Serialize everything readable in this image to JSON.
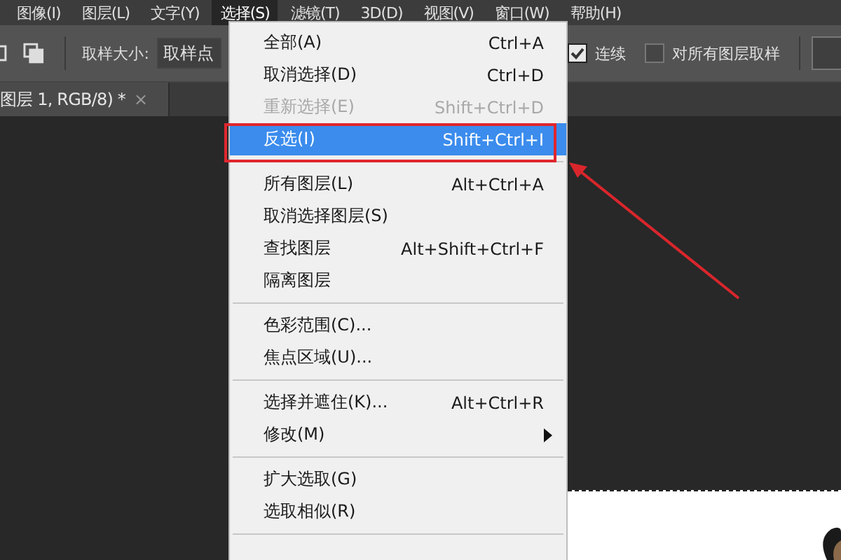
{
  "menu_bar": [
    {
      "label": "图像(I)",
      "selected": false
    },
    {
      "label": "图层(L)",
      "selected": false
    },
    {
      "label": "文字(Y)",
      "selected": false
    },
    {
      "label": "选择(S)",
      "selected": true
    },
    {
      "label": "滤镜(T)",
      "selected": false
    },
    {
      "label": "3D(D)",
      "selected": false
    },
    {
      "label": "视图(V)",
      "selected": false
    },
    {
      "label": "窗口(W)",
      "selected": false
    },
    {
      "label": "帮助(H)",
      "selected": false
    }
  ],
  "options_bar": {
    "sample_size_label": "取样大小:",
    "sample_size_value": "取样点",
    "checkboxes": [
      {
        "label": "连续",
        "checked": true
      },
      {
        "label": "对所有图层取样",
        "checked": false
      }
    ]
  },
  "document_tab": {
    "title": "图层 1, RGB/8) *",
    "close": "×"
  },
  "menu": {
    "items": [
      {
        "kind": "item",
        "label": "全部(A)",
        "shortcut": "Ctrl+A",
        "disabled": false,
        "selected": false
      },
      {
        "kind": "item",
        "label": "取消选择(D)",
        "shortcut": "Ctrl+D",
        "disabled": false,
        "selected": false
      },
      {
        "kind": "item",
        "label": "重新选择(E)",
        "shortcut": "Shift+Ctrl+D",
        "disabled": true,
        "selected": false
      },
      {
        "kind": "item",
        "label": "反选(I)",
        "shortcut": "Shift+Ctrl+I",
        "disabled": false,
        "selected": true
      },
      {
        "kind": "separator"
      },
      {
        "kind": "item",
        "label": "所有图层(L)",
        "shortcut": "Alt+Ctrl+A",
        "disabled": false,
        "selected": false
      },
      {
        "kind": "item",
        "label": "取消选择图层(S)",
        "disabled": false,
        "selected": false
      },
      {
        "kind": "item",
        "label": "查找图层",
        "shortcut": "Alt+Shift+Ctrl+F",
        "disabled": false,
        "selected": false
      },
      {
        "kind": "item",
        "label": "隔离图层",
        "disabled": false,
        "selected": false
      },
      {
        "kind": "separator"
      },
      {
        "kind": "item",
        "label": "色彩范围(C)...",
        "disabled": false,
        "selected": false
      },
      {
        "kind": "item",
        "label": "焦点区域(U)...",
        "disabled": false,
        "selected": false
      },
      {
        "kind": "separator"
      },
      {
        "kind": "item",
        "label": "选择并遮住(K)...",
        "shortcut": "Alt+Ctrl+R",
        "disabled": false,
        "selected": false
      },
      {
        "kind": "item",
        "label": "修改(M)",
        "submenu": true,
        "disabled": false,
        "selected": false
      },
      {
        "kind": "separator"
      },
      {
        "kind": "item",
        "label": "扩大选取(G)",
        "disabled": false,
        "selected": false
      },
      {
        "kind": "item",
        "label": "选取相似(R)",
        "disabled": false,
        "selected": false
      },
      {
        "kind": "separator"
      }
    ]
  }
}
